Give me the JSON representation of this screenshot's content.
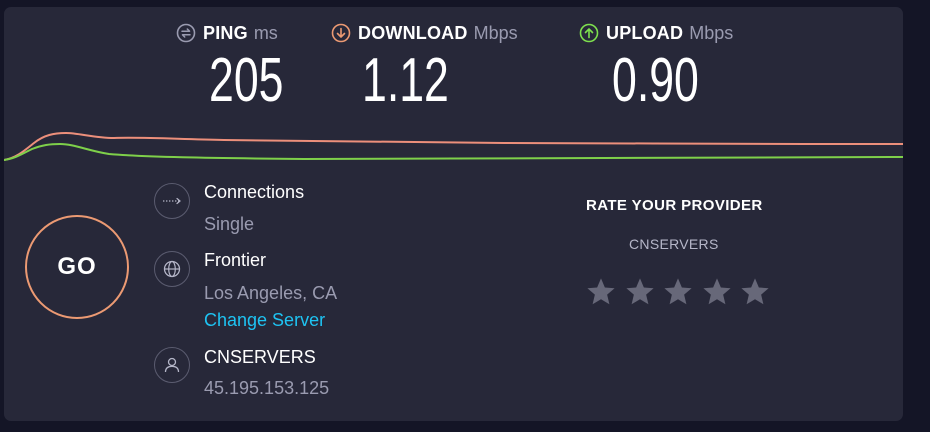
{
  "metrics": {
    "ping": {
      "label": "PING",
      "unit": "ms",
      "value": "205",
      "icon": "ping-icon",
      "color": "#9a9bb0"
    },
    "download": {
      "label": "DOWNLOAD",
      "unit": "Mbps",
      "value": "1.12",
      "icon": "download-arrow-icon",
      "color": "#ec9a73"
    },
    "upload": {
      "label": "UPLOAD",
      "unit": "Mbps",
      "value": "0.90",
      "icon": "upload-arrow-icon",
      "color": "#7ee04e"
    }
  },
  "go": {
    "label": "GO",
    "color": "#ec9a73"
  },
  "connection": {
    "title": "Connections",
    "mode": "Single",
    "icon": "connections-arrow-icon"
  },
  "server": {
    "title": "Frontier",
    "location": "Los Angeles, CA",
    "change_link": "Change Server",
    "icon": "globe-icon"
  },
  "provider": {
    "title": "CNSERVERS",
    "ip": "45.195.153.125",
    "icon": "user-icon"
  },
  "rating": {
    "title": "RATE YOUR PROVIDER",
    "provider_name": "CNSERVERS",
    "star_count": 5,
    "selected": 0,
    "star_color": "#676879"
  },
  "colors": {
    "background": "#141526",
    "panel": "#272839",
    "link": "#1ec3f2"
  }
}
